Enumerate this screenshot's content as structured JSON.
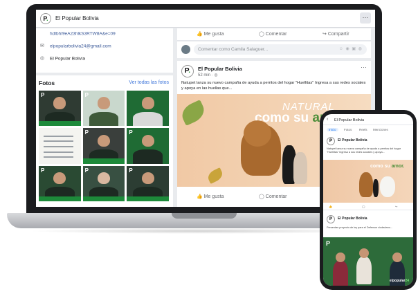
{
  "laptop": {
    "page_name": "El Popular Bolivia",
    "info": {
      "link_fragment": "hdIbhI9eA23hlkS3RTW8A&e=09",
      "email": "elpopularbolivia24@gmail.com",
      "messenger": "El Popular Bolivia"
    },
    "photos": {
      "title": "Fotos",
      "see_all": "Ver todas las fotos"
    },
    "feed": {
      "like": "Me gusta",
      "comment": "Comentar",
      "share": "Compartir",
      "comment_placeholder": "Comentar como Camila Salaguer..."
    },
    "post": {
      "author": "El Popular Bolivia",
      "time": "52 min · ◎",
      "text": "Natupet lanza su nuevo campaña de ayuda a perritos del hogar \"Huellitas\" Ingresa a sus redes sociales y apoya en las huellas que..."
    },
    "image": {
      "headline_top": "NATURAL",
      "headline_main": "como su",
      "headline_accent": "amor"
    }
  },
  "phone": {
    "page_name": "El Popular Bolivia",
    "tabs": [
      "Inicio",
      "Fotos",
      "Reels",
      "Menciones"
    ],
    "post1": {
      "author": "El Popular Bolivia",
      "text": "Natupet lanza su nueva campaña de ayuda a perritos del hogar \"Huellitas\" ingresa a sus redes sociales y apoya..."
    },
    "image": {
      "headline_main": "como su",
      "headline_accent": "amor."
    },
    "post2": {
      "author": "El Popular Bolivia",
      "text": "Presentan proyecto de ley para el Defensor ciudadano...",
      "watermark_a": "elpopular",
      "watermark_b": "24"
    }
  }
}
